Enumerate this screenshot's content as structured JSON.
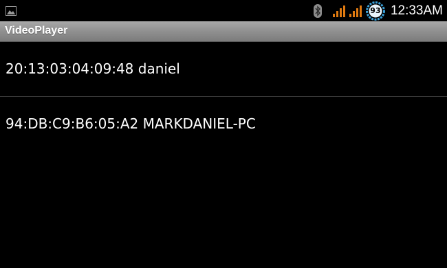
{
  "status_bar": {
    "left_icon": "gallery-image-icon",
    "bluetooth_icon": "bluetooth-icon",
    "signal_icons": [
      "signal-strength-icon",
      "signal-strength-icon"
    ],
    "battery_level": "93",
    "time": "12:33AM",
    "colors": {
      "signal": "#e07a10",
      "battery_ring": "#3aa0d8"
    }
  },
  "title_bar": {
    "title": "VideoPlayer"
  },
  "devices": [
    {
      "label": "20:13:03:04:09:48 daniel"
    },
    {
      "label": "94:DB:C9:B6:05:A2 MARKDANIEL-PC"
    }
  ]
}
